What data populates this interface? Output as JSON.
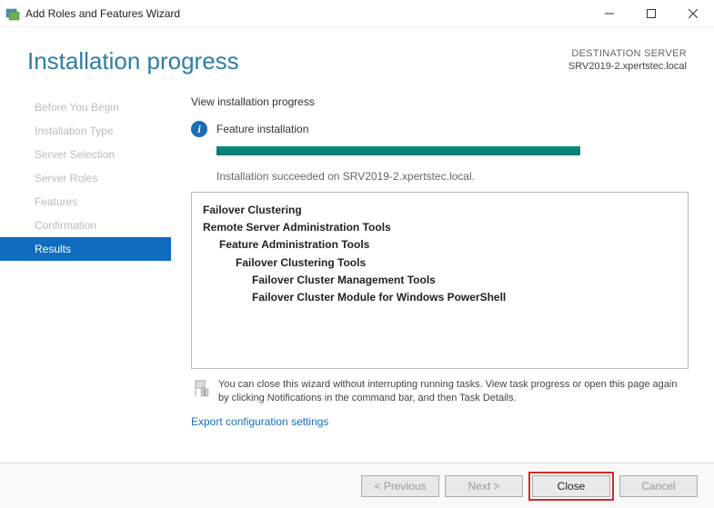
{
  "window": {
    "title": "Add Roles and Features Wizard"
  },
  "header": {
    "title": "Installation progress",
    "destination_label": "DESTINATION SERVER",
    "destination_server": "SRV2019-2.xpertstec.local"
  },
  "sidebar": {
    "items": [
      {
        "label": "Before You Begin"
      },
      {
        "label": "Installation Type"
      },
      {
        "label": "Server Selection"
      },
      {
        "label": "Server Roles"
      },
      {
        "label": "Features"
      },
      {
        "label": "Confirmation"
      },
      {
        "label": "Results"
      }
    ]
  },
  "main": {
    "progress_header": "View installation progress",
    "status_label": "Feature installation",
    "succeeded_text": "Installation succeeded on SRV2019-2.xpertstec.local.",
    "features": {
      "l0": "Failover Clustering",
      "l1": "Remote Server Administration Tools",
      "l2": "Feature Administration Tools",
      "l3": "Failover Clustering Tools",
      "l4a": "Failover Cluster Management Tools",
      "l4b": "Failover Cluster Module for Windows PowerShell"
    },
    "hint": "You can close this wizard without interrupting running tasks. View task progress or open this page again by clicking Notifications in the command bar, and then Task Details.",
    "export_link": "Export configuration settings"
  },
  "footer": {
    "previous": "< Previous",
    "next": "Next >",
    "close": "Close",
    "cancel": "Cancel"
  }
}
